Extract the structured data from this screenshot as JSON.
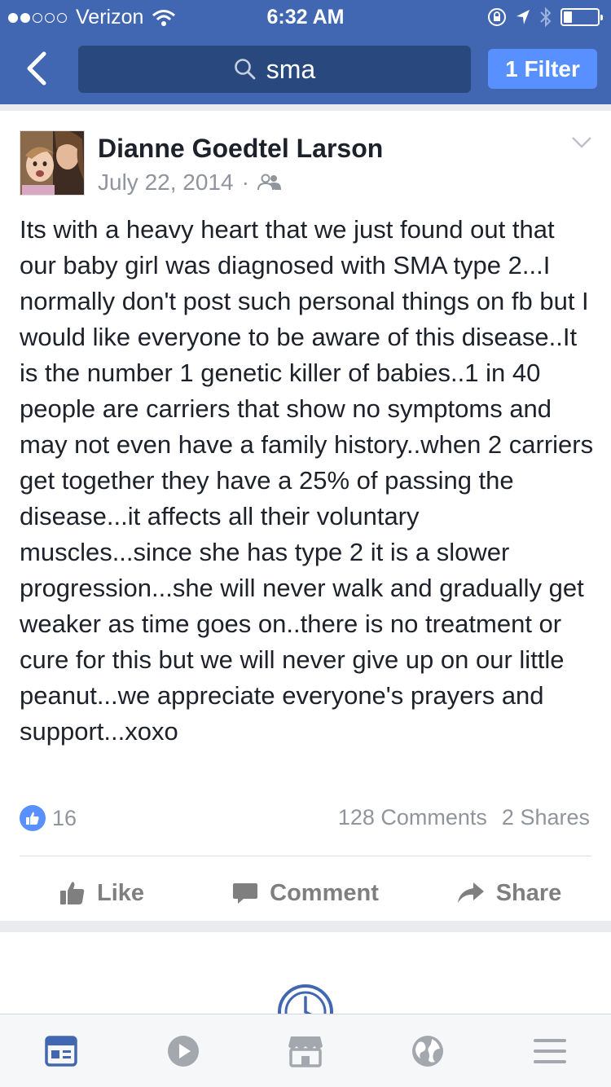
{
  "status_bar": {
    "carrier": "Verizon",
    "signal_bars_filled": 2,
    "signal_bars_total": 5,
    "time": "6:32 AM",
    "battery_level": 0.25
  },
  "nav": {
    "back_icon": "chevron-left-icon",
    "search_query": "sma",
    "filter_label": "1 Filter"
  },
  "post": {
    "author": "Dianne Goedtel Larson",
    "date": "July 22, 2014",
    "separator": "·",
    "audience_icon": "friends-icon",
    "text": "Its with a heavy heart that we just found out that our baby girl was diagnosed with SMA type 2...I normally don't post such personal things on fb but I would like everyone to be aware of this disease..It is the number 1 genetic killer of babies..1 in 40 people are carriers that show no symptoms and may not even have a family history..when 2 carriers get together they have a 25% of passing the disease...it affects all their voluntary muscles...since she has type 2 it is a slower progression...she will never walk and gradually get weaker as time goes on..there is no treatment or cure for this but we will never give up on our little peanut...we appreciate everyone's prayers and support...xoxo",
    "like_count": "16",
    "comments": "128 Comments",
    "shares": "2 Shares",
    "actions": {
      "like": "Like",
      "comment": "Comment",
      "share": "Share"
    }
  },
  "colors": {
    "brand": "#4267b2",
    "search_bg": "#29487d",
    "filter_bg": "#5890ff",
    "muted_text": "#90949c"
  },
  "tabbar": {
    "items": [
      "news-feed-icon",
      "video-icon",
      "marketplace-icon",
      "globe-icon",
      "menu-icon"
    ],
    "active": "news-feed-icon"
  }
}
